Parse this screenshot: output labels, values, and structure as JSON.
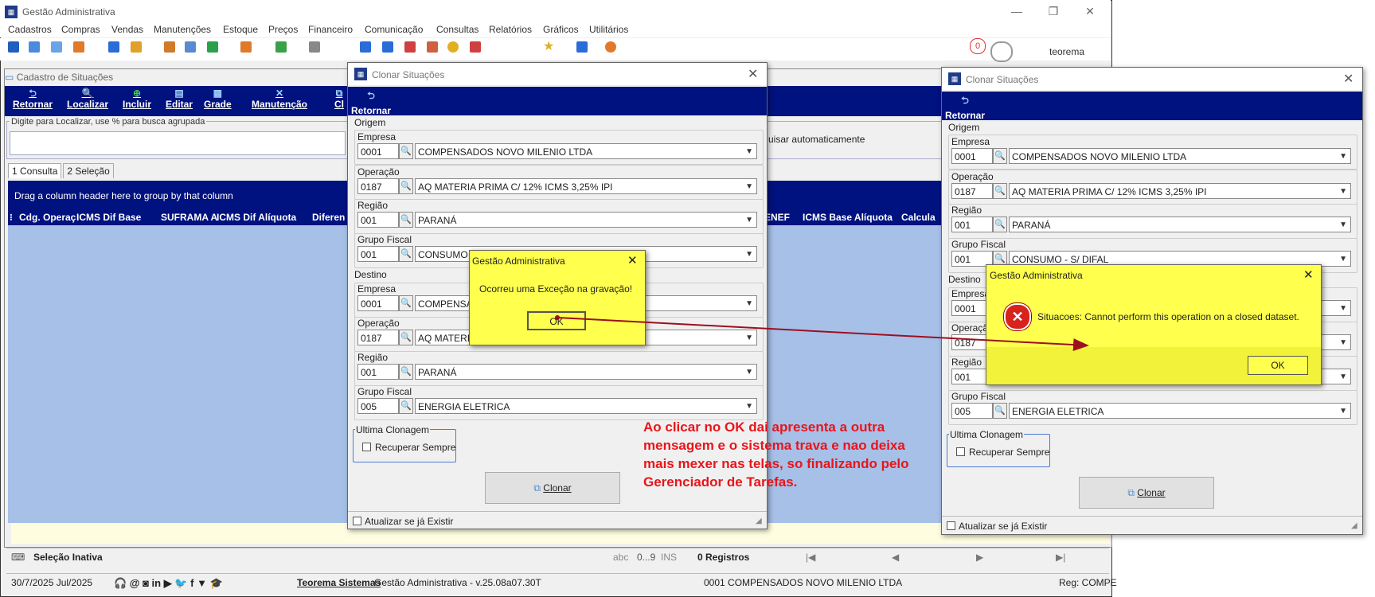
{
  "app": {
    "title": "Gestão Administrativa",
    "menu": [
      "Cadastros",
      "Compras",
      "Vendas",
      "Manutenções",
      "Estoque",
      "Preços",
      "Financeiro",
      "Comunicação",
      "Consultas",
      "Relatórios",
      "Gráficos",
      "Utilitários"
    ],
    "user": "teorema",
    "notif_count": "0"
  },
  "cadastro": {
    "title": "Cadastro de Situações",
    "toolbar": [
      "Retornar",
      "Localizar",
      "Incluir",
      "Editar",
      "Grade",
      "Manutenção",
      "Cl"
    ],
    "search_label": "Digite para Localizar, use % para busca agrupada",
    "search_auto": "uisar automaticamente",
    "tabs": [
      "1 Consulta",
      "2 Seleção"
    ],
    "group_hint": "Drag a column header here to group by that column",
    "columns": [
      "Cdg. Operaç",
      "ICMS Dif Base",
      "SUFRAMA A",
      "ICMS Dif Alíquota",
      "Diferen",
      "ENEF",
      "ICMS Base Alíquota",
      "Calcula"
    ]
  },
  "status1": {
    "selecao": "Seleção Inativa",
    "abc": "abc",
    "digits": "0...9",
    "ins": "INS",
    "registros": "0 Registros"
  },
  "status2": {
    "date": "30/7/2025 Jul/2025",
    "company": "Teorema Sistemas",
    "version": "Gestão Administrativa - v.25.08a07.30T",
    "empresa": "0001 COMPENSADOS NOVO MILENIO LTDA",
    "reg": "Reg: COMPE"
  },
  "dialog_left": {
    "title": "Clonar Situações",
    "retornar": "Retornar",
    "origem": "Origem",
    "destino": "Destino",
    "origem_fields": [
      {
        "label": "Empresa",
        "code": "0001",
        "value": "COMPENSADOS NOVO MILENIO LTDA"
      },
      {
        "label": "Operação",
        "code": "0187",
        "value": "AQ MATERIA PRIMA C/ 12% ICMS 3,25% IPI"
      },
      {
        "label": "Região",
        "code": "001",
        "value": "PARANÁ"
      },
      {
        "label": "Grupo Fiscal",
        "code": "001",
        "value": "CONSUMO - S/ DIF"
      }
    ],
    "destino_fields": [
      {
        "label": "Empresa",
        "code": "0001",
        "value": "COMPENSA"
      },
      {
        "label": "Operação",
        "code": "0187",
        "value": "AQ MATERIA"
      },
      {
        "label": "Região",
        "code": "001",
        "value": "PARANÁ"
      },
      {
        "label": "Grupo Fiscal",
        "code": "005",
        "value": "ENERGIA ELETRICA"
      }
    ],
    "ultima": "Ultima Clonagem",
    "recuperar": "Recuperar Sempre",
    "clonar": "Clonar",
    "atualizar": "Atualizar se já Existir"
  },
  "msg_left": {
    "title": "Gestão Administrativa",
    "text": "Ocorreu uma Exceção na gravação!",
    "ok": "OK"
  },
  "dialog_right": {
    "title": "Clonar Situações",
    "retornar": "Retornar",
    "origem": "Origem",
    "destino": "Destino",
    "origem_fields": [
      {
        "label": "Empresa",
        "code": "0001",
        "value": "COMPENSADOS NOVO MILENIO LTDA"
      },
      {
        "label": "Operação",
        "code": "0187",
        "value": "AQ MATERIA PRIMA C/ 12% ICMS 3,25% IPI"
      },
      {
        "label": "Região",
        "code": "001",
        "value": "PARANÁ"
      },
      {
        "label": "Grupo Fiscal",
        "code": "001",
        "value": "CONSUMO - S/ DIFAL"
      }
    ],
    "destino_fields": [
      {
        "label": "Empresa",
        "code": "0001",
        "value": ""
      },
      {
        "label": "Operação",
        "code": "0187",
        "value": ""
      },
      {
        "label": "Região",
        "code": "001",
        "value": ""
      },
      {
        "label": "Grupo Fiscal",
        "code": "005",
        "value": "ENERGIA ELETRICA"
      }
    ],
    "ultima": "Ultima Clonagem",
    "recuperar": "Recuperar Sempre",
    "clonar": "Clonar",
    "atualizar": "Atualizar se já Existir"
  },
  "msg_right": {
    "title": "Gestão Administrativa",
    "text": "Situacoes: Cannot perform this operation on a closed dataset.",
    "ok": "OK"
  },
  "annotation": "Ao clicar no OK dai apresenta a outra mensagem e o sistema trava e nao deixa mais mexer nas telas, so finalizando pelo Gerenciador de Tarefas.",
  "colors": {
    "navy": "#00127f",
    "grid": "#a7c0e8",
    "msg": "#ffff4d",
    "note": "#e8151b",
    "arrow": "#9b1020"
  }
}
